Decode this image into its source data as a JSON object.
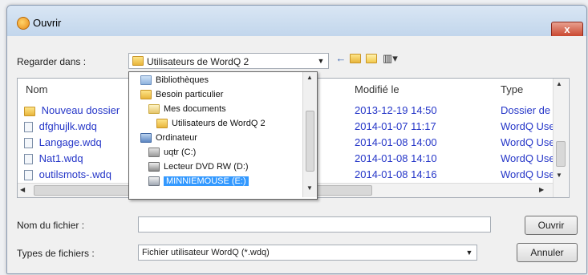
{
  "window": {
    "title": "Ouvrir",
    "close_glyph": "x"
  },
  "look_in": {
    "label": "Regarder dans :",
    "value": "Utilisateurs de WordQ 2"
  },
  "toolbar": {
    "icons": [
      "back-arrow-icon",
      "up-folder-icon",
      "new-folder-icon",
      "view-menu-icon"
    ]
  },
  "columns": {
    "name": "Nom",
    "modified": "Modifié le",
    "type": "Type"
  },
  "files": [
    {
      "name": "Nouveau dossier",
      "modified": "2013-12-19 14:50",
      "type": "Dossier de f"
    },
    {
      "name": "dfghujlk.wdq",
      "modified": "2014-01-07 11:17",
      "type": "WordQ User"
    },
    {
      "name": "Langage.wdq",
      "modified": "2014-01-08 14:00",
      "type": "WordQ User"
    },
    {
      "name": "Nat1.wdq",
      "modified": "2014-01-08 14:10",
      "type": "WordQ User"
    },
    {
      "name": "outilsmots-.wdq",
      "modified": "2014-01-08 14:16",
      "type": "WordQ User"
    }
  ],
  "dropdown": {
    "items": [
      {
        "label": "Bibliothèques",
        "icon": "libraries-icon"
      },
      {
        "label": "Besoin particulier",
        "icon": "user-folder-icon"
      },
      {
        "label": "Mes documents",
        "icon": "documents-icon"
      },
      {
        "label": "Utilisateurs de WordQ 2",
        "icon": "folder-icon"
      },
      {
        "label": "Ordinateur",
        "icon": "computer-icon"
      },
      {
        "label": "uqtr (C:)",
        "icon": "drive-icon"
      },
      {
        "label": "Lecteur DVD RW (D:)",
        "icon": "dvd-drive-icon"
      },
      {
        "label": "MINNIEMOUSE (E:)",
        "icon": "usb-drive-icon"
      }
    ]
  },
  "filename": {
    "label": "Nom du fichier :",
    "value": ""
  },
  "filetype": {
    "label": "Types de fichiers :",
    "value": "Fichier utilisateur WordQ (*.wdq)"
  },
  "buttons": {
    "open": "Ouvrir",
    "cancel": "Annuler"
  },
  "colors": {
    "link_blue": "#2536c8",
    "selection": "#3399ff"
  }
}
